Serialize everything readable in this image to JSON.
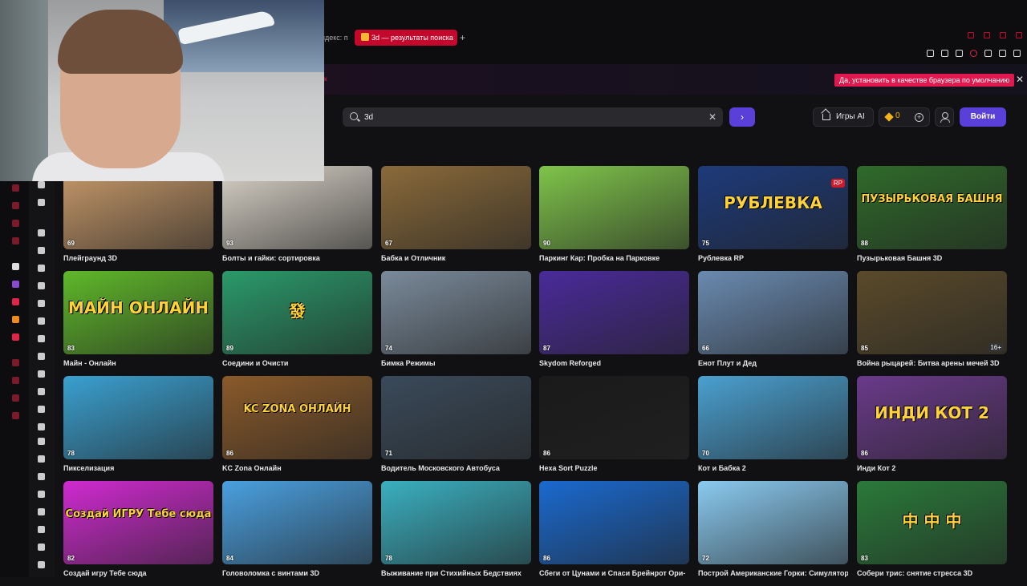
{
  "browser": {
    "prev_tab_label": "ндекс: п",
    "active_tab_label": "3d — результаты поиска",
    "new_tab_label": "+",
    "notification_button": "Да, установить в качестве браузера по умолчанию",
    "notification_close": "✕",
    "notification_left_text": "к"
  },
  "header": {
    "search_value": "3d",
    "search_clear": "✕",
    "go_label": "›",
    "ai_games_label": "Игры AI",
    "coin_count": "0",
    "coin_plus": "+",
    "login_label": "Войти"
  },
  "colors": {
    "accent": "#5a3fd8",
    "notify": "#e01a4f",
    "tab_active": "#c4072c",
    "coin": "#f6b21b"
  },
  "games": [
    {
      "title": "Плейграунд 3D",
      "rating": "69",
      "bg": "#c89a6a"
    },
    {
      "title": "Болты и гайки: сортировка",
      "rating": "93",
      "bg": "#d9d3c8"
    },
    {
      "title": "Бабка и Отличник",
      "rating": "67",
      "bg": "#8a6a3a"
    },
    {
      "title": "Паркинг Кар: Пробка на Парковке",
      "rating": "90",
      "bg": "#7fc44a"
    },
    {
      "title": "Рублевка RP",
      "rating": "75",
      "bg": "#1d3a7a",
      "overlay": "РУБЛЕВКА",
      "overlay_badge": "RP"
    },
    {
      "title": "Пузырьковая Башня 3D",
      "rating": "88",
      "bg": "#2f6a2a",
      "overlay": "ПУЗЫРЬКОВАЯ БАШНЯ"
    },
    {
      "title": "Майн - Онлайн",
      "rating": "83",
      "bg": "#5fb82a",
      "overlay": "МАЙН ОНЛАЙН"
    },
    {
      "title": "Соедини и Очисти",
      "rating": "89",
      "bg": "#2a9a6a",
      "overlay": "發"
    },
    {
      "title": "Бимка Режимы",
      "rating": "74",
      "bg": "#7a8a9a"
    },
    {
      "title": "Skydom Reforged",
      "rating": "87",
      "bg": "#4a2a9a"
    },
    {
      "title": "Енот Плут и Дед",
      "rating": "66",
      "bg": "#6a8ab0"
    },
    {
      "title": "Война рыцарей: Битва арены мечей 3D",
      "rating": "85",
      "bg": "#5a4a2a",
      "overlay_badge": "16+"
    },
    {
      "title": "Пикселизация",
      "rating": "78",
      "bg": "#3aa0d0"
    },
    {
      "title": "KC Zona Онлайн",
      "rating": "86",
      "bg": "#8a5a2a",
      "overlay": "KC ZONA ОНЛАЙН"
    },
    {
      "title": "Водитель Московского Автобуса",
      "rating": "71",
      "bg": "#3a4a5a"
    },
    {
      "title": "Hexa Sort Puzzle",
      "rating": "86",
      "bg": "#1a1a1a"
    },
    {
      "title": "Кот и Бабка 2",
      "rating": "70",
      "bg": "#4aa0d0"
    },
    {
      "title": "Инди Кот 2",
      "rating": "86",
      "bg": "#6a3a8a",
      "overlay": "ИНДИ КОТ 2"
    },
    {
      "title": "Создай игру Тебе сюда",
      "rating": "82",
      "bg": "#d02ad0",
      "overlay": "Создай ИГРУ Тебе сюда"
    },
    {
      "title": "Головоломка с винтами 3D",
      "rating": "84",
      "bg": "#4aa0e0"
    },
    {
      "title": "Выживание при Стихийных Бедствиях",
      "rating": "78",
      "bg": "#3ab0c0"
    },
    {
      "title": "Сбеги от Цунами и Спаси Брейнрот Ори-",
      "rating": "86",
      "bg": "#1a6ad0"
    },
    {
      "title": "Построй Американские Горки: Симулятор",
      "rating": "72",
      "bg": "#8acaf0"
    },
    {
      "title": "Собери трис: снятие стресса 3D",
      "rating": "83",
      "bg": "#2a7a3a",
      "overlay": "中 中 中"
    }
  ]
}
